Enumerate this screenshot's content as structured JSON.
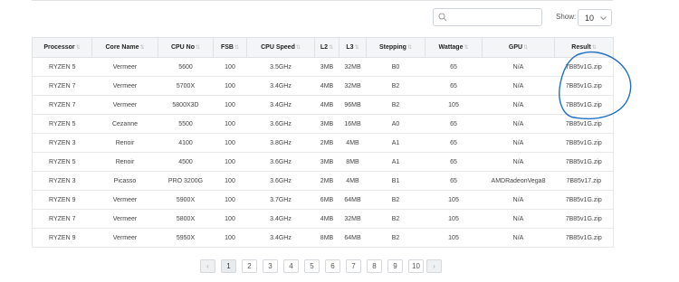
{
  "toolbar": {
    "search_placeholder": "",
    "show_label": "Show:",
    "page_size": "10"
  },
  "table": {
    "columns": [
      "Processor",
      "Core Name",
      "CPU No",
      "FSB",
      "CPU Speed",
      "L2",
      "L3",
      "Stepping",
      "Wattage",
      "GPU",
      "Result"
    ],
    "rows": [
      [
        "RYZEN 5",
        "Vermeer",
        "5600",
        "100",
        "3.5GHz",
        "3MB",
        "32MB",
        "B0",
        "65",
        "N/A",
        "7B85v1G.zip"
      ],
      [
        "RYZEN 7",
        "Vermeer",
        "5700X",
        "100",
        "3.4GHz",
        "4MB",
        "32MB",
        "B2",
        "65",
        "N/A",
        "7B85v1G.zip"
      ],
      [
        "RYZEN 7",
        "Vermeer",
        "5800X3D",
        "100",
        "3.4GHz",
        "4MB",
        "96MB",
        "B2",
        "105",
        "N/A",
        "7B85v1G.zip"
      ],
      [
        "RYZEN 5",
        "Cezanne",
        "5500",
        "100",
        "3.6GHz",
        "3MB",
        "16MB",
        "A0",
        "65",
        "N/A",
        "7B85v1G.zip"
      ],
      [
        "RYZEN 3",
        "Renoir",
        "4100",
        "100",
        "3.8GHz",
        "2MB",
        "4MB",
        "A1",
        "65",
        "N/A",
        "7B85v1G.zip"
      ],
      [
        "RYZEN 5",
        "Renoir",
        "4500",
        "100",
        "3.6GHz",
        "3MB",
        "8MB",
        "A1",
        "65",
        "N/A",
        "7B85v1G.zip"
      ],
      [
        "RYZEN 3",
        "Picasso",
        "PRO 3200G",
        "100",
        "3.6GHz",
        "2MB",
        "4MB",
        "B1",
        "65",
        "AMDRadeonVega8",
        "7B85v17.zip"
      ],
      [
        "RYZEN 9",
        "Vermeer",
        "5900X",
        "100",
        "3.7GHz",
        "6MB",
        "64MB",
        "B2",
        "105",
        "N/A",
        "7B85v1G.zip"
      ],
      [
        "RYZEN 7",
        "Vermeer",
        "5800X",
        "100",
        "3.4GHz",
        "4MB",
        "32MB",
        "B2",
        "105",
        "N/A",
        "7B85v1G.zip"
      ],
      [
        "RYZEN 9",
        "Vermeer",
        "5950X",
        "100",
        "3.4GHz",
        "8MB",
        "64MB",
        "B2",
        "105",
        "N/A",
        "7B85v1G.zip"
      ]
    ]
  },
  "pagination": {
    "prev": "‹",
    "next": "›",
    "pages": [
      "1",
      "2",
      "3",
      "4",
      "5",
      "6",
      "7",
      "8",
      "9",
      "10"
    ],
    "current": "1"
  },
  "icons": {
    "search": "search-icon",
    "sort": "sort-icon",
    "dropdown": "chevron-down-icon"
  },
  "colors": {
    "annotation": "#1f6fc4",
    "header_bg": "#f4f5f7",
    "border": "#dee2e6"
  }
}
